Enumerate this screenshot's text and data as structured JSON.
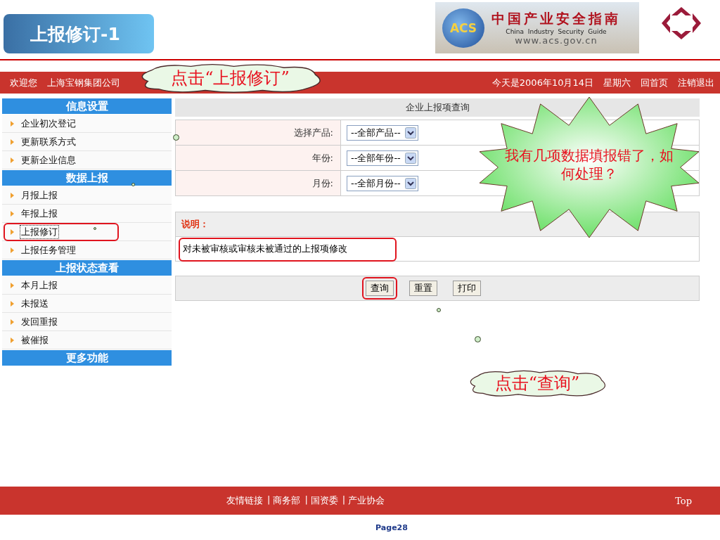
{
  "slide": {
    "title": "上报修订-1",
    "page_label": "Page28"
  },
  "logo": {
    "badge": "ACS",
    "title_cn": "中国产业安全指南",
    "title_en": "China  Industry  Security  Guide",
    "url": "www.acs.gov.cn"
  },
  "topbar": {
    "welcome": "欢迎您",
    "company": "上海宝钢集团公司",
    "date": "今天是2006年10月14日",
    "weekday": "星期六",
    "links": [
      "回首页",
      "注销退出"
    ]
  },
  "sidebar": {
    "sections": [
      {
        "title": "信息设置",
        "items": [
          {
            "label": "企业初次登记",
            "selected": false,
            "highlighted": false
          },
          {
            "label": "更新联系方式",
            "selected": false,
            "highlighted": false
          },
          {
            "label": "更新企业信息",
            "selected": false,
            "highlighted": false
          }
        ]
      },
      {
        "title": "数据上报",
        "items": [
          {
            "label": "月报上报",
            "selected": false,
            "highlighted": false
          },
          {
            "label": "年报上报",
            "selected": false,
            "highlighted": false
          },
          {
            "label": "上报修订",
            "selected": true,
            "highlighted": true
          },
          {
            "label": "上报任务管理",
            "selected": false,
            "highlighted": false
          }
        ]
      },
      {
        "title": "上报状态查看",
        "items": [
          {
            "label": "本月上报",
            "selected": false,
            "highlighted": false
          },
          {
            "label": "未报送",
            "selected": false,
            "highlighted": false
          },
          {
            "label": "发回重报",
            "selected": false,
            "highlighted": false
          },
          {
            "label": "被催报",
            "selected": false,
            "highlighted": false
          }
        ]
      },
      {
        "title": "更多功能"
      }
    ]
  },
  "form": {
    "title": "企业上报项查询",
    "fields": [
      {
        "label": "选择产品:",
        "value": "--全部产品--"
      },
      {
        "label": "年份:",
        "value": "--全部年份--"
      },
      {
        "label": "月份:",
        "value": "--全部月份--"
      }
    ],
    "note": {
      "heading": "说明：",
      "text": "对未被审核或审核未被通过的上报项修改",
      "highlighted": true
    },
    "buttons": [
      {
        "label": "查询",
        "highlighted": true
      },
      {
        "label": "重置",
        "highlighted": false
      },
      {
        "label": "打印",
        "highlighted": false
      }
    ]
  },
  "footer": {
    "links": [
      "友情链接",
      "商务部",
      "国资委",
      "产业协会"
    ],
    "separator": "|",
    "top": "Top"
  },
  "callouts": [
    {
      "kind": "cloud",
      "text": "点击“上报修订”"
    },
    {
      "kind": "starburst",
      "text": "我有几项数据填报错了，如何处理？"
    },
    {
      "kind": "cloud",
      "text": "点击“查询”"
    }
  ]
}
